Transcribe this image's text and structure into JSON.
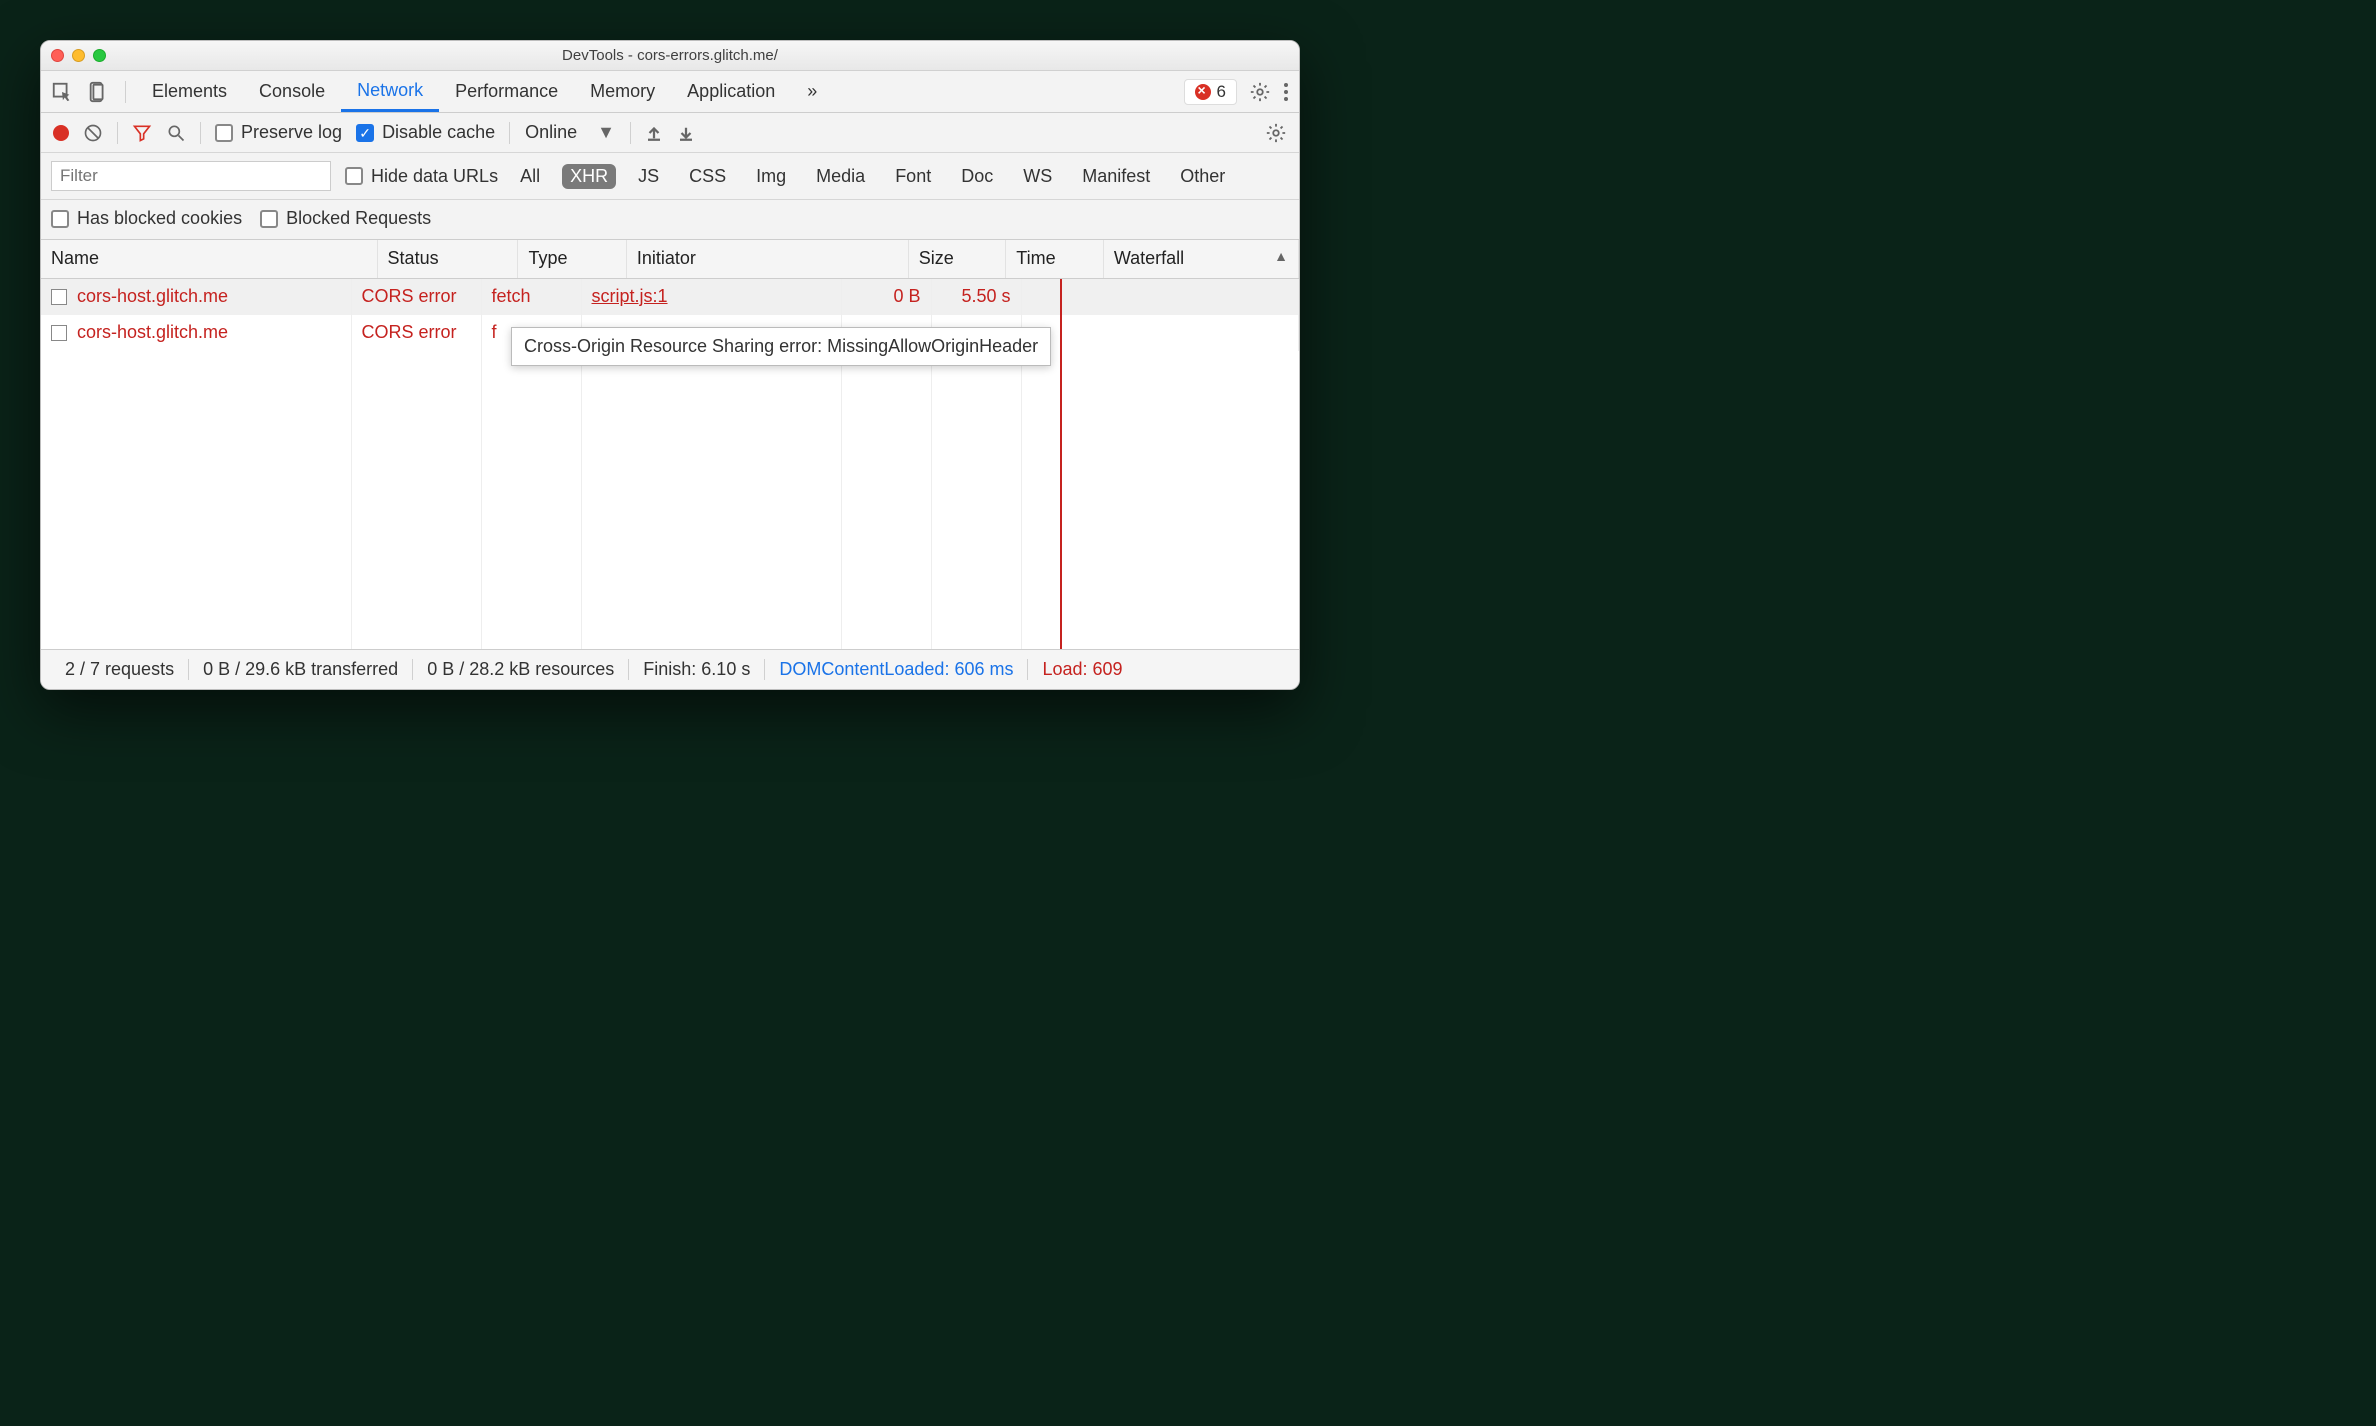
{
  "titlebar": {
    "title": "DevTools - cors-errors.glitch.me/"
  },
  "tabs": {
    "items": [
      "Elements",
      "Console",
      "Network",
      "Performance",
      "Memory",
      "Application"
    ],
    "active": "Network",
    "more_icon": "»",
    "error_count": "6"
  },
  "toolbar2": {
    "preserve_log": "Preserve log",
    "disable_cache": "Disable cache",
    "throttle": "Online"
  },
  "filterbar": {
    "placeholder": "Filter",
    "hide_data_urls": "Hide data URLs",
    "types": [
      "All",
      "XHR",
      "JS",
      "CSS",
      "Img",
      "Media",
      "Font",
      "Doc",
      "WS",
      "Manifest",
      "Other"
    ],
    "selected": "XHR",
    "has_blocked": "Has blocked cookies",
    "blocked_requests": "Blocked Requests"
  },
  "columns": {
    "name": "Name",
    "status": "Status",
    "type": "Type",
    "initiator": "Initiator",
    "size": "Size",
    "time": "Time",
    "waterfall": "Waterfall"
  },
  "rows": [
    {
      "name": "cors-host.glitch.me",
      "status": "CORS error",
      "type": "fetch",
      "initiator": "script.js:1",
      "size": "0 B",
      "time": "5.50 s"
    },
    {
      "name": "cors-host.glitch.me",
      "status": "CORS error",
      "type": "f",
      "initiator": "",
      "size": "",
      "time": ""
    }
  ],
  "tooltip": "Cross-Origin Resource Sharing error: MissingAllowOriginHeader",
  "status": {
    "requests": "2 / 7 requests",
    "transferred": "0 B / 29.6 kB transferred",
    "resources": "0 B / 28.2 kB resources",
    "finish": "Finish: 6.10 s",
    "dcl": "DOMContentLoaded: 606 ms",
    "load": "Load: 609"
  }
}
